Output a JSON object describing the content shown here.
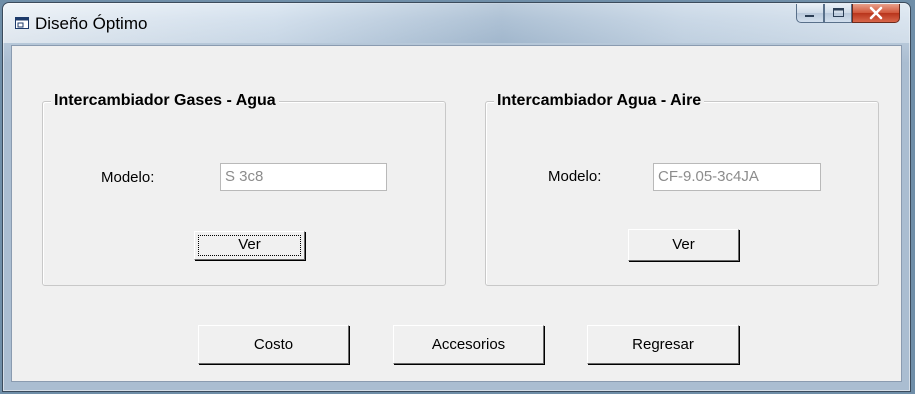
{
  "window": {
    "title": "Diseño Óptimo"
  },
  "group_left": {
    "title": "Intercambiador Gases - Agua",
    "model_label": "Modelo:",
    "model_value": "S 3c8",
    "view_label": "Ver"
  },
  "group_right": {
    "title": "Intercambiador Agua - Aire",
    "model_label": "Modelo:",
    "model_value": "CF-9.05-3c4JA",
    "view_label": "Ver"
  },
  "actions": {
    "cost_label": "Costo",
    "accessories_label": "Accesorios",
    "back_label": "Regresar"
  },
  "colors": {
    "close_button": "#c8472c",
    "client_bg": "#f0f0f0"
  }
}
